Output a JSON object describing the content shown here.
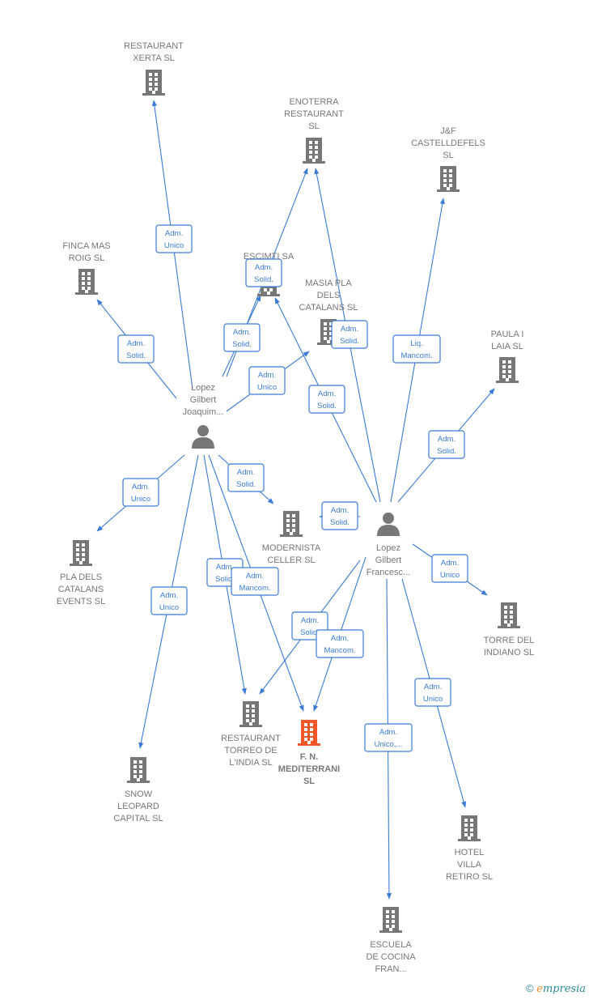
{
  "colors": {
    "edge": "#3a7bd5",
    "building": "#777777",
    "highlight": "#f0582a",
    "person": "#777777"
  },
  "nodes": [
    {
      "id": "xerta",
      "type": "company",
      "lines": [
        "RESTAURANT",
        "XERTA  SL"
      ]
    },
    {
      "id": "enoterra",
      "type": "company",
      "lines": [
        "ENOTERRA",
        "RESTAURANT",
        "SL"
      ]
    },
    {
      "id": "jf",
      "type": "company",
      "lines": [
        "J&F",
        "CASTELLDEFELS",
        "SL"
      ]
    },
    {
      "id": "finca",
      "type": "company",
      "lines": [
        "FINCA MAS",
        "ROIG  SL"
      ]
    },
    {
      "id": "escimti",
      "type": "company",
      "lines": [
        "ESCIMTI SA"
      ]
    },
    {
      "id": "masia",
      "type": "company",
      "lines": [
        "MASIA PLA",
        "DELS",
        "CATALANS  SL"
      ]
    },
    {
      "id": "paula",
      "type": "company",
      "lines": [
        "PAULA I",
        "LAIA  SL"
      ]
    },
    {
      "id": "p1",
      "type": "person",
      "lines": [
        "Lopez",
        "Gilbert",
        "Joaquim..."
      ]
    },
    {
      "id": "p2",
      "type": "person",
      "lines": [
        "Lopez",
        "Gilbert",
        "Francesc..."
      ]
    },
    {
      "id": "modernista",
      "type": "company",
      "lines": [
        "MODERNISTA",
        "CELLER  SL"
      ]
    },
    {
      "id": "plaevents",
      "type": "company",
      "lines": [
        "PLA DELS",
        "CATALANS",
        "EVENTS  SL"
      ]
    },
    {
      "id": "torre",
      "type": "company",
      "lines": [
        "TORRE DEL",
        "INDIANO  SL"
      ]
    },
    {
      "id": "torreo",
      "type": "company",
      "lines": [
        "RESTAURANT",
        "TORREO DE",
        "L'INDIA  SL"
      ]
    },
    {
      "id": "fn",
      "type": "company",
      "highlight": true,
      "lines": [
        "F. N.",
        "MEDITERRANI",
        "SL"
      ]
    },
    {
      "id": "snow",
      "type": "company",
      "lines": [
        "SNOW",
        "LEOPARD",
        "CAPITAL  SL"
      ]
    },
    {
      "id": "hotel",
      "type": "company",
      "lines": [
        "HOTEL",
        "VILLA",
        "RETIRO  SL"
      ]
    },
    {
      "id": "escuela",
      "type": "company",
      "lines": [
        "ESCUELA",
        "DE COCINA",
        "FRAN..."
      ]
    }
  ],
  "edges": [
    {
      "id": "p1-xerta",
      "from": "p1",
      "to": "xerta",
      "label": [
        "Adm.",
        "Unico"
      ]
    },
    {
      "id": "p1-finca",
      "from": "p1",
      "to": "finca",
      "label": [
        "Adm.",
        "Solid."
      ]
    },
    {
      "id": "p1-escimti",
      "from": "p1",
      "to": "escimti",
      "label": [
        "Adm.",
        "Solid."
      ]
    },
    {
      "id": "p1-enoterra",
      "from": "p1",
      "to": "enoterra",
      "label": [
        "Adm.",
        "Solid."
      ]
    },
    {
      "id": "p1-masia",
      "from": "p1",
      "to": "masia",
      "label": [
        "Adm.",
        "Unico"
      ]
    },
    {
      "id": "p1-plaevents",
      "from": "p1",
      "to": "plaevents",
      "label": [
        "Adm.",
        "Unico"
      ]
    },
    {
      "id": "p1-modernista",
      "from": "p1",
      "to": "modernista",
      "label": [
        "Adm.",
        "Solid."
      ]
    },
    {
      "id": "p1-snow",
      "from": "p1",
      "to": "snow",
      "label": [
        "Adm.",
        "Unico"
      ]
    },
    {
      "id": "p1-torreo",
      "from": "p1",
      "to": "torreo",
      "label": [
        "Adm.",
        "Solid."
      ]
    },
    {
      "id": "p1-fn",
      "from": "p1",
      "to": "fn",
      "label": [
        "Adm.",
        "Mancom."
      ]
    },
    {
      "id": "p2-enoterra",
      "from": "p2",
      "to": "enoterra",
      "label": [
        "Adm.",
        "Solid."
      ]
    },
    {
      "id": "p2-escimti",
      "from": "p2",
      "to": "escimti",
      "label": [
        "Adm.",
        "Solid."
      ]
    },
    {
      "id": "p2-jf",
      "from": "p2",
      "to": "jf",
      "label": [
        "Liq.",
        "Mancom."
      ]
    },
    {
      "id": "p2-paula",
      "from": "p2",
      "to": "paula",
      "label": [
        "Adm.",
        "Solid."
      ]
    },
    {
      "id": "p2-modernista",
      "from": "p2",
      "to": "modernista",
      "label": [
        "Adm.",
        "Solid."
      ]
    },
    {
      "id": "p2-torre",
      "from": "p2",
      "to": "torre",
      "label": [
        "Adm.",
        "Unico"
      ]
    },
    {
      "id": "p2-torreo",
      "from": "p2",
      "to": "torreo",
      "label": [
        "Adm.",
        "Solid."
      ]
    },
    {
      "id": "p2-fn",
      "from": "p2",
      "to": "fn",
      "label": [
        "Adm.",
        "Mancom."
      ]
    },
    {
      "id": "p2-escuela",
      "from": "p2",
      "to": "escuela",
      "label": [
        "Adm.",
        "Unico,..."
      ]
    },
    {
      "id": "p2-hotel",
      "from": "p2",
      "to": "hotel",
      "label": [
        "Adm.",
        "Unico"
      ]
    }
  ],
  "footer": {
    "copyright": "©",
    "brand_initial": "e",
    "brand_rest": "mpresia"
  }
}
